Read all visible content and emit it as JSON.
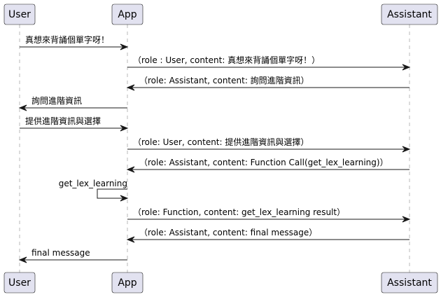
{
  "participants": [
    {
      "id": "user",
      "label": "User"
    },
    {
      "id": "app",
      "label": "App"
    },
    {
      "id": "assistant",
      "label": "Assistant"
    }
  ],
  "messages": [
    {
      "from": "user",
      "to": "app",
      "text": "真想來背誦個單字呀！"
    },
    {
      "from": "app",
      "to": "assistant",
      "text": "（role : User, content: 真想來背誦個單字呀！）"
    },
    {
      "from": "assistant",
      "to": "app",
      "text": "（role: Assistant, content: 詢問進階資訊）"
    },
    {
      "from": "app",
      "to": "user",
      "text": "詢問進階資訊"
    },
    {
      "from": "user",
      "to": "app",
      "text": "提供進階資訊與選擇"
    },
    {
      "from": "app",
      "to": "assistant",
      "text": "（role: User, content: 提供進階資訊與選擇）"
    },
    {
      "from": "assistant",
      "to": "app",
      "text": "（role: Assistant, content: Function Call(get_lex_learning)）"
    },
    {
      "from": "app",
      "to": "app",
      "text": "get_lex_learning"
    },
    {
      "from": "app",
      "to": "assistant",
      "text": "（role: Function, content: get_lex_learning result）"
    },
    {
      "from": "assistant",
      "to": "app",
      "text": "（role: Assistant, content: final message）"
    },
    {
      "from": "app",
      "to": "user",
      "text": "final message"
    }
  ]
}
